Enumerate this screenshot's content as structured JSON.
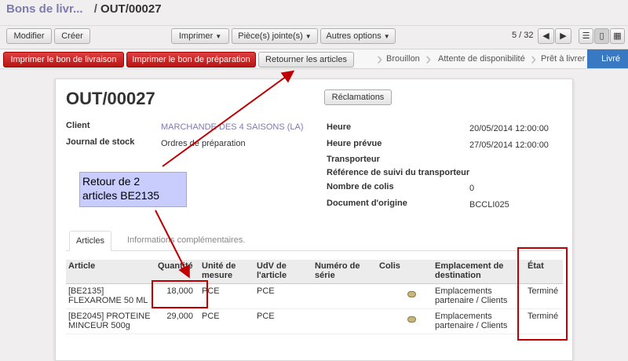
{
  "breadcrumb": {
    "parent": "Bons de livr...",
    "separator": "/",
    "current": "OUT/00027"
  },
  "toolbar": {
    "modifier": "Modifier",
    "creer": "Créer",
    "imprimer": "Imprimer",
    "pieces": "Pièce(s) jointe(s)",
    "autres": "Autres options",
    "pager": "5 / 32"
  },
  "actions": {
    "print_delivery": "Imprimer le bon de livraison",
    "print_prep": "Imprimer le bon de préparation",
    "return_items": "Retourner les articles"
  },
  "stages": [
    "Brouillon",
    "Attente de disponibilité",
    "Prêt à livrer",
    "Livré"
  ],
  "form": {
    "title": "OUT/00027",
    "reclamations": "Réclamations",
    "client_label": "Client",
    "client_value": "MARCHANDE DES 4 SAISONS (LA)",
    "journal_label": "Journal de stock",
    "journal_value": "Ordres de préparation",
    "heure_label": "Heure",
    "heure_value": "20/05/2014 12:00:00",
    "heure_prevue_label": "Heure prévue",
    "heure_prevue_value": "27/05/2014 12:00:00",
    "transporteur_label": "Transporteur",
    "suivi_label": "Référence de suivi du transporteur",
    "colis_label": "Nombre de colis",
    "colis_value": "0",
    "origine_label": "Document d'origine",
    "origine_value": "BCCLI025"
  },
  "tabs": {
    "articles": "Articles",
    "infos": "Informations complémentaires."
  },
  "table": {
    "headers": [
      "Article",
      "Quantité",
      "Unité de mesure",
      "UdV de l'article",
      "Numéro de série",
      "Colis",
      "Emplacement de destination",
      "État"
    ],
    "rows": [
      {
        "article": "[BE2135] FLEXAROME 50 ML",
        "quantite": "18,000",
        "unite": "PCE",
        "udv": "PCE",
        "serie": "",
        "emplacement": "Emplacements partenaire / Clients",
        "etat": "Terminé"
      },
      {
        "article": "[BE2045] PROTEINE MINCEUR 500g",
        "quantite": "29,000",
        "unite": "PCE",
        "udv": "PCE",
        "serie": "",
        "emplacement": "Emplacements partenaire / Clients",
        "etat": "Terminé"
      }
    ]
  },
  "annotation": {
    "line1": "Retour de 2",
    "line2": "articles BE2135"
  },
  "colors": {
    "primary_red": "#c41c1c",
    "active_stage": "#3978c2",
    "link": "#7c7bad",
    "annotation_red": "#c00000",
    "annotation_bg": "#c8cdfd"
  }
}
